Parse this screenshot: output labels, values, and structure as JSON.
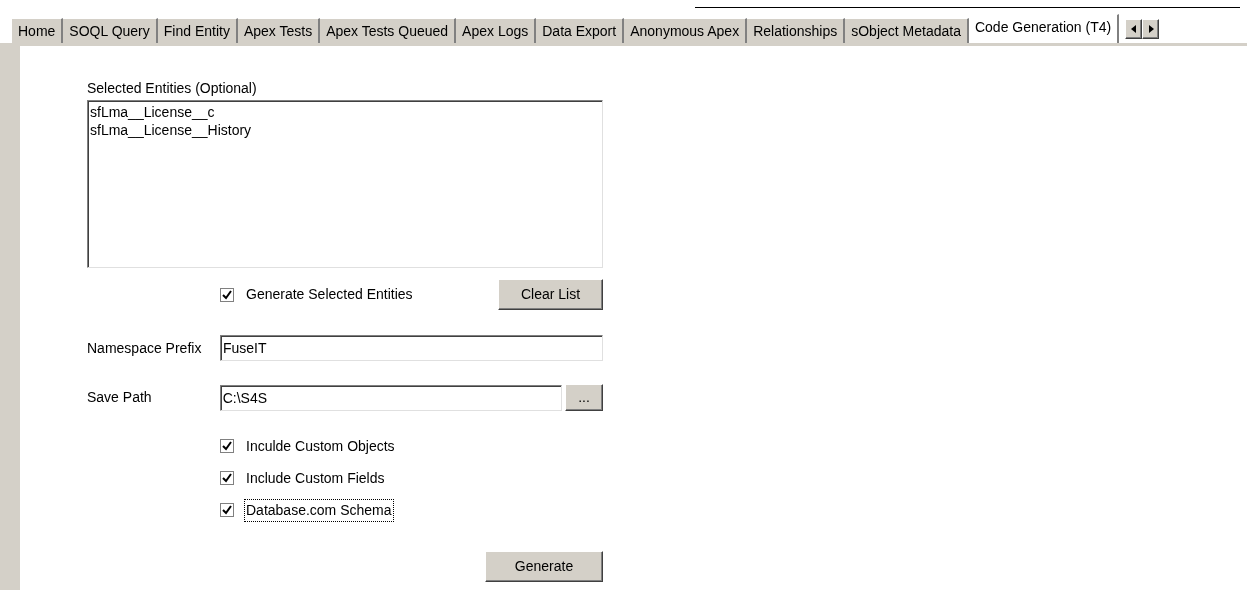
{
  "tabs": [
    {
      "label": "Home",
      "selected": false
    },
    {
      "label": "SOQL Query",
      "selected": false
    },
    {
      "label": "Find Entity",
      "selected": false
    },
    {
      "label": "Apex Tests",
      "selected": false
    },
    {
      "label": "Apex Tests Queued",
      "selected": false
    },
    {
      "label": "Apex Logs",
      "selected": false
    },
    {
      "label": "Data Export",
      "selected": false
    },
    {
      "label": "Anonymous Apex",
      "selected": false
    },
    {
      "label": "Relationships",
      "selected": false
    },
    {
      "label": "sObject Metadata",
      "selected": false
    },
    {
      "label": "Code Generation (T4)",
      "selected": true
    }
  ],
  "selected_entities": {
    "label": "Selected Entities (Optional)",
    "items": [
      "sfLma__License__c",
      "sfLma__License__History"
    ]
  },
  "generate_selected": {
    "label": "Generate Selected Entities",
    "checked": true
  },
  "clear_button": "Clear List",
  "namespace": {
    "label": "Namespace Prefix",
    "value": "FuseIT"
  },
  "save_path": {
    "label": "Save Path",
    "value": "C:\\S4S",
    "browse": "..."
  },
  "options": [
    {
      "label": "Inculde Custom Objects",
      "checked": true,
      "focused": false
    },
    {
      "label": "Include Custom Fields",
      "checked": true,
      "focused": false
    },
    {
      "label": "Database.com Schema",
      "checked": true,
      "focused": true
    }
  ],
  "generate_button": "Generate"
}
